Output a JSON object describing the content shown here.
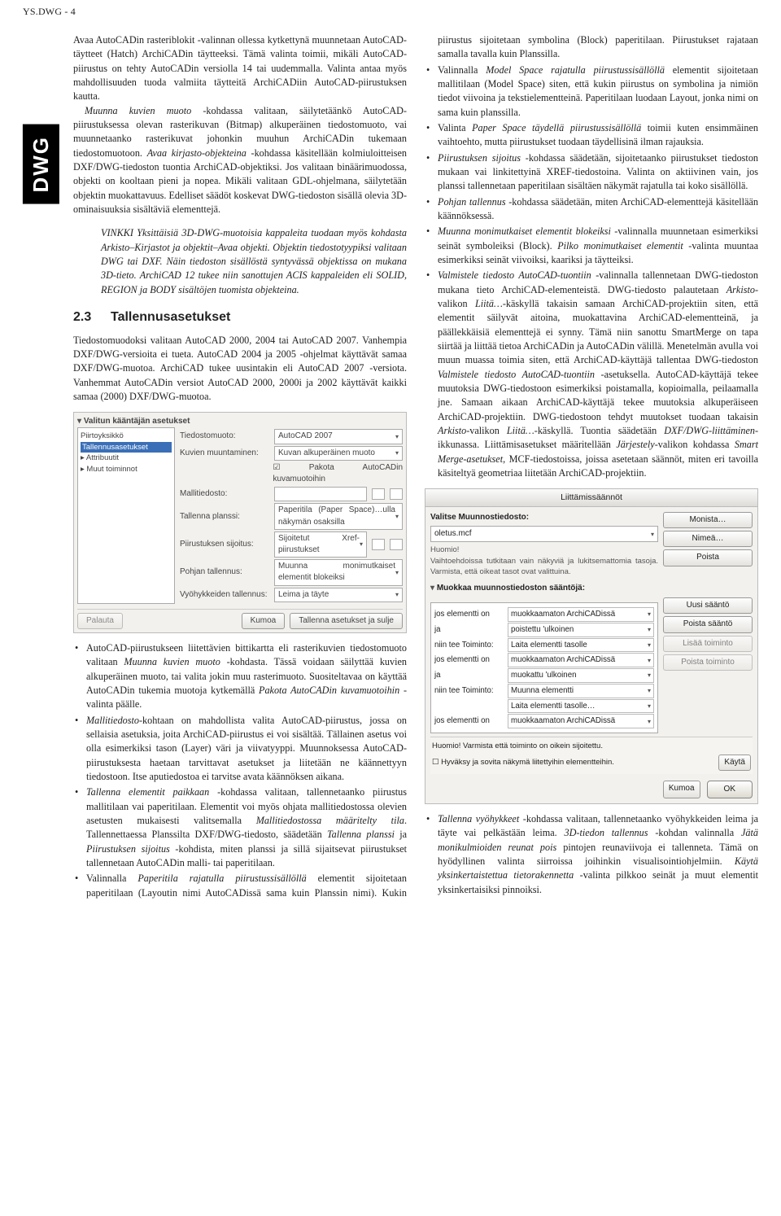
{
  "header": "YS.DWG - 4",
  "side_tab": "DWG",
  "col1": {
    "p1": "Avaa AutoCADin rasteriblokit -valinnan ollessa kytkettynä muunnetaan AutoCAD-täytteet (Hatch) ArchiCADin täytteeksi. Tämä valinta toimii, mikäli AutoCAD-piirustus on tehty AutoCADin versiolla 14 tai uudemmalla. Valinta antaa myös mahdollisuuden tuoda valmiita täytteitä ArchiCADiin AutoCAD-piirustuksen kautta.",
    "p2a": "Muunna kuvien muoto",
    "p2b": " -kohdassa valitaan, säilytetäänkö AutoCAD-piirustuksessa olevan rasterikuvan (Bitmap) alkuperäinen tiedostomuoto, vai muunnetaanko rasterikuvat johonkin muuhun ArchiCADin tukemaan tiedostomuotoon. ",
    "p2c": "Avaa kirjasto-objekteina",
    "p2d": " -kohdassa käsitellään kolmiuloitteisen DXF/DWG-tiedoston tuontia ArchiCAD-objektiksi. Jos valitaan binäärimuodossa, objekti on kooltaan pieni ja nopea. Mikäli valitaan GDL-ohjelmana, säilytetään objektin muokattavuus. Edelliset säädöt koskevat DWG-tiedoston sisällä olevia 3D-ominaisuuksia sisältäviä elementtejä.",
    "tip": "VINKKI Yksittäisiä 3D-DWG-muotoisia kappaleita tuodaan myös kohdasta Arkisto–Kirjastot ja objektit–Avaa objekti. Objektin tiedostotyypiksi valitaan DWG tai DXF. Näin tiedoston sisällöstä syntyvässä objektissa on mukana 3D-tieto. ArchiCAD 12 tukee niin sanottujen ACIS kappaleiden eli SOLID, REGION ja BODY sisältöjen tuomista objekteina.",
    "h2_num": "2.3",
    "h2_txt": "Tallennusasetukset",
    "p3": "Tiedostomuodoksi valitaan AutoCAD 2000, 2004 tai AutoCAD 2007. Vanhempia DXF/DWG-versioita ei tueta. AutoCAD 2004 ja 2005 -ohjelmat käyttävät samaa DXF/DWG-muotoa. ArchiCAD tukee uusintakin eli AutoCAD 2007 -versiota. Vanhemmat AutoCADin versiot AutoCAD 2000, 2000i ja 2002 käyttävät kaikki samaa (2000) DXF/DWG-muotoa."
  },
  "fig1": {
    "header": "Valitun kääntäjän asetukset",
    "tree": [
      "Piirtoyksikkö",
      "Tallennusasetukset",
      "Attribuutit",
      "Muut toiminnot"
    ],
    "rows": {
      "r1l": "Tiedostomuoto:",
      "r1v": "AutoCAD 2007",
      "r2l": "Kuvien muuntaminen:",
      "r2v": "Kuvan alkuperäinen muoto",
      "r2chk": "Pakota AutoCADin kuvamuotoihin",
      "r3l": "Mallitiedosto:",
      "r4l": "Tallenna planssi:",
      "r4v": "Paperitila (Paper Space)…ulla näkymän osaksilla",
      "r5l": "Piirustuksen sijoitus:",
      "r5v": "Sijoitetut Xref-piirustukset",
      "r6l": "Pohjan tallennus:",
      "r6v": "Muunna monimutkaiset elementit blokeiksi",
      "r7l": "Vyöhykkeiden tallennus:",
      "r7v": "Leima ja täyte"
    },
    "btn_back": "Palauta",
    "btn_cancel": "Kumoa",
    "btn_save": "Tallenna asetukset ja sulje"
  },
  "bullets1": [
    "AutoCAD-piirustukseen liitettävien bittikartta eli rasterikuvien tiedostomuoto valitaan <i>Muunna kuvien muoto</i> -kohdasta. Tässä voidaan säilyttää kuvien alkuperäinen muoto, tai valita jokin muu rasterimuoto. Suositeltavaa on käyttää AutoCADin tukemia muotoja kytkemällä <i>Pakota AutoCADin kuvamuotoihin</i> -valinta päälle.",
    "<i>Mallitiedosto</i>-kohtaan on mahdollista valita AutoCAD-piirustus, jossa on sellaisia asetuksia, joita ArchiCAD-piirustus ei voi sisältää. Tällainen asetus voi olla esimerkiksi tason (Layer) väri ja viivatyyppi. Muunnoksessa AutoCAD-piirustuksesta haetaan tarvittavat asetukset ja liitetään ne käännettyyn tiedostoon. Itse aputiedostoa ei tarvitse avata käännöksen aikana.",
    "<i>Tallenna elementit paikkaan</i> -kohdassa valitaan, tallennetaanko piirustus mallitilaan vai paperitilaan. Elementit voi myös ohjata mallitiedostossa olevien asetusten mukaisesti valitsemalla <i>Mallitiedostossa määritelty tila</i>. Tallennettaessa Planssilta DXF/DWG-tiedosto, säädetään <i>Tallenna planssi</i> ja <i>Piirustuksen sijoitus</i> -kohdista, miten planssi ja sillä sijaitsevat piirustukset tallennetaan AutoCADin malli- tai paperitilaan.",
    "Valinnalla <i>Paperitila rajatulla piirustussisällöllä</i> elementit sijoitetaan paperitilaan (Layoutin nimi AutoCADissä sama kuin Planssin nimi). Kukin piirustus sijoitetaan symbolina (Block) paperitilaan. Piirustukset rajataan samalla tavalla kuin Planssilla.",
    "Valinnalla <i>Model Space rajatulla piirustussisällöllä</i> elementit sijoitetaan mallitilaan (Model Space) siten, että kukin piirustus on symbolina ja nimiön tiedot viivoina ja tekstielementteinä. Paperitilaan luodaan Layout, jonka nimi on sama kuin planssilla.",
    "Valinta <i>Paper Space täydellä piirustussisällöllä</i> toimii kuten ensimmäinen vaihtoehto, mutta piirustukset tuodaan täydellisinä ilman rajauksia.",
    "<i>Piirustuksen sijoitus</i> -kohdassa säädetään, sijoitetaanko piirustukset tiedoston mukaan vai linkitettyinä XREF-tiedostoina. Valinta on aktiivinen vain, jos planssi tallennetaan paperitilaan sisältäen näkymät rajatulla tai koko sisällöllä.",
    "<i>Pohjan tallennus</i> -kohdassa säädetään, miten ArchiCAD-elementtejä käsitellään käännöksessä.",
    "<i>Muunna monimutkaiset elementit blokeiksi</i> -valinnalla muunnetaan esimerkiksi seinät symboleiksi (Block). <i>Pilko monimutkaiset elementit</i> -valinta muuntaa esimerkiksi seinät viivoiksi, kaariksi ja täytteiksi.",
    "<i>Valmistele tiedosto AutoCAD-tuontiin</i> -valinnalla tallennetaan DWG-tiedoston mukana tieto ArchiCAD-elementeistä. DWG-tiedosto palautetaan <i>Arkisto</i>-valikon <i>Liitä…</i>-käskyllä takaisin samaan ArchiCAD-projektiin siten, että elementit säilyvät aitoina, muokattavina ArchiCAD-elementteinä, ja päällekkäisiä elementtejä ei synny. Tämä niin sanottu SmartMerge on tapa siirtää ja liittää tietoa ArchiCADin ja AutoCADin välillä. Menetelmän avulla voi muun muassa toimia siten, että ArchiCAD-käyttäjä tallentaa DWG-tiedoston <i>Valmistele tiedosto AutoCAD-tuontiin</i> -asetuksella. AutoCAD-käyttäjä tekee muutoksia DWG-tiedostoon esimerkiksi poistamalla, kopioimalla, peilaamalla jne. Samaan aikaan ArchiCAD-käyttäjä tekee muutoksia alkuperäiseen ArchiCAD-projektiin. DWG-tiedostoon tehdyt muutokset tuodaan takaisin <i>Arkisto</i>-valikon <i>Liitä…</i>-käskyllä. Tuontia säädetään <i>DXF/DWG-liittäminen</i>-ikkunassa. Liittämisasetukset määritellään <i>Järjestely</i>-valikon kohdassa <i>Smart Merge-asetukset</i>, MCF-tiedostoissa, joissa asetetaan säännöt, miten eri tavoilla käsiteltyä geometriaa liitetään ArchiCAD-projektiin."
  ],
  "fig2": {
    "title": "Liittämissäännöt",
    "pick_label": "Valitse Muunnostiedosto:",
    "pick_value": "oletus.mcf",
    "btns_right": [
      "Monista…",
      "Nimeä…",
      "Poista"
    ],
    "note": "Huomio!\nVaihtoehdoissa tutkitaan vain näkyviä ja lukitsemattomia tasoja. Varmista, että oikeat tasot ovat valittuina.",
    "section": "Muokkaa muunnostiedoston sääntöjä:",
    "rules": [
      {
        "a": "jos elementti on",
        "b": "muokkaamaton ArchiCADissä"
      },
      {
        "a": "ja",
        "b": "poistettu 'ulkoinen"
      },
      {
        "a": "niin tee Toiminto:",
        "b": "Laita elementti tasolle"
      },
      {
        "a": "jos elementti on",
        "b": "muokkaamaton ArchiCADissä"
      },
      {
        "a": "ja",
        "b": "muokattu 'ulkoinen"
      },
      {
        "a": "niin tee Toiminto:",
        "b": "Muunna elementti"
      },
      {
        "a": "",
        "b": "Laita elementti tasolle…"
      },
      {
        "a": "jos elementti on",
        "b": "muokkaamaton ArchiCADissä"
      }
    ],
    "side_btns": [
      "Uusi sääntö",
      "Poista sääntö",
      "Lisää toiminto",
      "Poista toiminto"
    ],
    "hint_label": "Huomio! Varmista että toiminto on oikein sijoitettu.",
    "hint_chk": "Hyväksy ja sovita näkymä liitettyihin elementteihin.",
    "apply": "Käytä",
    "cancel": "Kumoa",
    "ok": "OK"
  },
  "bullets2": [
    "<i>Tallenna vyöhykkeet</i> -kohdassa valitaan, tallennetaanko vyöhykkeiden leima ja täyte vai pelkästään leima. <i>3D-tiedon tallennus</i> -kohdan valinnalla <i>Jätä monikulmioiden reunat pois</i> pintojen reunaviivoja ei tallenneta. Tämä on hyödyllinen valinta siirroissa joihinkin visualisointiohjelmiin. <i>Käytä yksinkertaistettua tietorakennetta</i> -valinta pilkkoo seinät ja muut elementit yksinkertaisiksi pinnoiksi."
  ]
}
